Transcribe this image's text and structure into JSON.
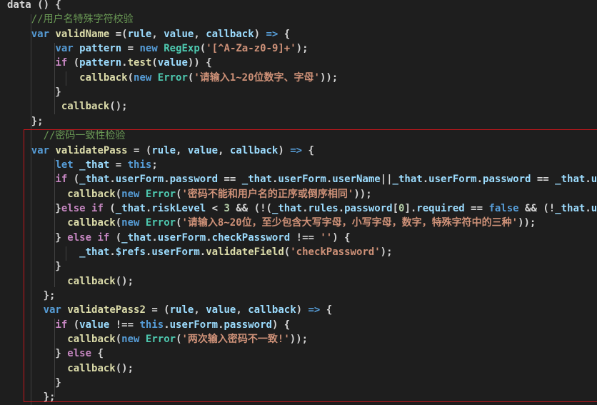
{
  "editor": {
    "theme": {
      "background": "#1e1e1e",
      "keyword": "#569cd6",
      "control": "#c586c0",
      "function": "#dcdcaa",
      "variable": "#9cdcfe",
      "string": "#ce9178",
      "number": "#b5cea8",
      "class": "#4ec9b0",
      "comment": "#6a9955",
      "plain": "#d4d4d4",
      "highlight_border": "#c4161c"
    },
    "lines": [
      [
        [
          "pl",
          "data () {"
        ]
      ],
      [
        [
          "pl",
          "    "
        ],
        [
          "cmt",
          "//用户名特殊字符校验"
        ]
      ],
      [
        [
          "pl",
          "    "
        ],
        [
          "kw",
          "var"
        ],
        [
          "pl",
          " "
        ],
        [
          "fn",
          "validName"
        ],
        [
          "pl",
          " =("
        ],
        [
          "prm",
          "rule"
        ],
        [
          "pl",
          ", "
        ],
        [
          "prm",
          "value"
        ],
        [
          "pl",
          ", "
        ],
        [
          "prm",
          "callback"
        ],
        [
          "pl",
          ") "
        ],
        [
          "kw",
          "=>"
        ],
        [
          "pl",
          " {"
        ]
      ],
      [
        [
          "pl",
          "        "
        ],
        [
          "kw",
          "var"
        ],
        [
          "pl",
          " "
        ],
        [
          "prm",
          "pattern"
        ],
        [
          "pl",
          " = "
        ],
        [
          "kw",
          "new"
        ],
        [
          "pl",
          " "
        ],
        [
          "cls",
          "RegExp"
        ],
        [
          "pl",
          "("
        ],
        [
          "str",
          "'[^A-Za-z0-9]+'"
        ],
        [
          "pl",
          ");"
        ]
      ],
      [
        [
          "pl",
          "        "
        ],
        [
          "ctl",
          "if"
        ],
        [
          "pl",
          " ("
        ],
        [
          "prm",
          "pattern"
        ],
        [
          "pl",
          "."
        ],
        [
          "fn",
          "test"
        ],
        [
          "pl",
          "("
        ],
        [
          "prm",
          "value"
        ],
        [
          "pl",
          ")) {"
        ]
      ],
      [
        [
          "pl",
          "            "
        ],
        [
          "fn",
          "callback"
        ],
        [
          "pl",
          "("
        ],
        [
          "kw",
          "new"
        ],
        [
          "pl",
          " "
        ],
        [
          "cls",
          "Error"
        ],
        [
          "pl",
          "("
        ],
        [
          "str",
          "'请输入1~20位数字、字母'"
        ],
        [
          "pl",
          "));"
        ]
      ],
      [
        [
          "pl",
          "        }"
        ]
      ],
      [
        [
          "pl",
          "         "
        ],
        [
          "fn",
          "callback"
        ],
        [
          "pl",
          "();"
        ]
      ],
      [
        [
          "pl",
          "    };"
        ]
      ],
      [
        [
          "pl",
          "      "
        ],
        [
          "cmt",
          "//密码一致性检验"
        ]
      ],
      [
        [
          "pl",
          "    "
        ],
        [
          "kw",
          "var"
        ],
        [
          "pl",
          " "
        ],
        [
          "fn",
          "validatePass"
        ],
        [
          "pl",
          " = ("
        ],
        [
          "prm",
          "rule"
        ],
        [
          "pl",
          ", "
        ],
        [
          "prm",
          "value"
        ],
        [
          "pl",
          ", "
        ],
        [
          "prm",
          "callback"
        ],
        [
          "pl",
          ") "
        ],
        [
          "kw",
          "=>"
        ],
        [
          "pl",
          " {"
        ]
      ],
      [
        [
          "pl",
          "        "
        ],
        [
          "kw",
          "let"
        ],
        [
          "pl",
          " "
        ],
        [
          "prm",
          "_that"
        ],
        [
          "pl",
          " = "
        ],
        [
          "kw",
          "this"
        ],
        [
          "pl",
          ";"
        ]
      ],
      [
        [
          "pl",
          "        "
        ],
        [
          "ctl",
          "if"
        ],
        [
          "pl",
          " ("
        ],
        [
          "prm",
          "_that"
        ],
        [
          "pl",
          "."
        ],
        [
          "prm",
          "userForm"
        ],
        [
          "pl",
          "."
        ],
        [
          "prm",
          "password"
        ],
        [
          "pl",
          " == "
        ],
        [
          "prm",
          "_that"
        ],
        [
          "pl",
          "."
        ],
        [
          "prm",
          "userForm"
        ],
        [
          "pl",
          "."
        ],
        [
          "prm",
          "userName"
        ],
        [
          "pl",
          "||"
        ],
        [
          "prm",
          "_that"
        ],
        [
          "pl",
          "."
        ],
        [
          "prm",
          "userForm"
        ],
        [
          "pl",
          "."
        ],
        [
          "prm",
          "password"
        ],
        [
          "pl",
          " == "
        ],
        [
          "prm",
          "_that"
        ],
        [
          "pl",
          "."
        ],
        [
          "prm",
          "use"
        ]
      ],
      [
        [
          "pl",
          "          "
        ],
        [
          "fn",
          "callback"
        ],
        [
          "pl",
          "("
        ],
        [
          "kw",
          "new"
        ],
        [
          "pl",
          " "
        ],
        [
          "cls",
          "Error"
        ],
        [
          "pl",
          "("
        ],
        [
          "str",
          "'密码不能和用户名的正序或倒序相同'"
        ],
        [
          "pl",
          "));"
        ]
      ],
      [
        [
          "pl",
          "        }"
        ],
        [
          "ctl",
          "else"
        ],
        [
          "pl",
          " "
        ],
        [
          "ctl",
          "if"
        ],
        [
          "pl",
          " ("
        ],
        [
          "prm",
          "_that"
        ],
        [
          "pl",
          "."
        ],
        [
          "prm",
          "riskLevel"
        ],
        [
          "pl",
          " < "
        ],
        [
          "num",
          "3"
        ],
        [
          "pl",
          " && (!("
        ],
        [
          "prm",
          "_that"
        ],
        [
          "pl",
          "."
        ],
        [
          "prm",
          "rules"
        ],
        [
          "pl",
          "."
        ],
        [
          "prm",
          "password"
        ],
        [
          "pl",
          "["
        ],
        [
          "num",
          "0"
        ],
        [
          "pl",
          "]."
        ],
        [
          "prm",
          "required"
        ],
        [
          "pl",
          " == "
        ],
        [
          "kw",
          "false"
        ],
        [
          "pl",
          " && (!"
        ],
        [
          "prm",
          "_that"
        ],
        [
          "pl",
          "."
        ],
        [
          "prm",
          "use"
        ]
      ],
      [
        [
          "pl",
          "          "
        ],
        [
          "fn",
          "callback"
        ],
        [
          "pl",
          "("
        ],
        [
          "kw",
          "new"
        ],
        [
          "pl",
          " "
        ],
        [
          "cls",
          "Error"
        ],
        [
          "pl",
          "("
        ],
        [
          "str",
          "'请输入8~20位，至少包含大写字母，小写字母，数字，特殊字符中的三种'"
        ],
        [
          "pl",
          "));"
        ]
      ],
      [
        [
          "pl",
          "        } "
        ],
        [
          "ctl",
          "else"
        ],
        [
          "pl",
          " "
        ],
        [
          "ctl",
          "if"
        ],
        [
          "pl",
          " ("
        ],
        [
          "prm",
          "_that"
        ],
        [
          "pl",
          "."
        ],
        [
          "prm",
          "userForm"
        ],
        [
          "pl",
          "."
        ],
        [
          "prm",
          "checkPassword"
        ],
        [
          "pl",
          " !== "
        ],
        [
          "str",
          "''"
        ],
        [
          "pl",
          ") {"
        ]
      ],
      [
        [
          "pl",
          "            "
        ],
        [
          "prm",
          "_that"
        ],
        [
          "pl",
          "."
        ],
        [
          "prm",
          "$refs"
        ],
        [
          "pl",
          "."
        ],
        [
          "prm",
          "userForm"
        ],
        [
          "pl",
          "."
        ],
        [
          "fn",
          "validateField"
        ],
        [
          "pl",
          "("
        ],
        [
          "str",
          "'checkPassword'"
        ],
        [
          "pl",
          ");"
        ]
      ],
      [
        [
          "pl",
          "        }"
        ]
      ],
      [
        [
          "pl",
          "          "
        ],
        [
          "fn",
          "callback"
        ],
        [
          "pl",
          "();"
        ]
      ],
      [
        [
          "pl",
          "      };"
        ]
      ],
      [
        [
          "pl",
          "      "
        ],
        [
          "kw",
          "var"
        ],
        [
          "pl",
          " "
        ],
        [
          "fn",
          "validatePass2"
        ],
        [
          "pl",
          " = ("
        ],
        [
          "prm",
          "rule"
        ],
        [
          "pl",
          ", "
        ],
        [
          "prm",
          "value"
        ],
        [
          "pl",
          ", "
        ],
        [
          "prm",
          "callback"
        ],
        [
          "pl",
          ") "
        ],
        [
          "kw",
          "=>"
        ],
        [
          "pl",
          " {"
        ]
      ],
      [
        [
          "pl",
          "        "
        ],
        [
          "ctl",
          "if"
        ],
        [
          "pl",
          " ("
        ],
        [
          "prm",
          "value"
        ],
        [
          "pl",
          " !== "
        ],
        [
          "kw",
          "this"
        ],
        [
          "pl",
          "."
        ],
        [
          "prm",
          "userForm"
        ],
        [
          "pl",
          "."
        ],
        [
          "prm",
          "password"
        ],
        [
          "pl",
          ") {"
        ]
      ],
      [
        [
          "pl",
          "          "
        ],
        [
          "fn",
          "callback"
        ],
        [
          "pl",
          "("
        ],
        [
          "kw",
          "new"
        ],
        [
          "pl",
          " "
        ],
        [
          "cls",
          "Error"
        ],
        [
          "pl",
          "("
        ],
        [
          "str",
          "'两次输入密码不一致!'"
        ],
        [
          "pl",
          "));"
        ]
      ],
      [
        [
          "pl",
          "        } "
        ],
        [
          "ctl",
          "else"
        ],
        [
          "pl",
          " {"
        ]
      ],
      [
        [
          "pl",
          "          "
        ],
        [
          "fn",
          "callback"
        ],
        [
          "pl",
          "();"
        ]
      ],
      [
        [
          "pl",
          "        }"
        ]
      ],
      [
        [
          "pl",
          "      };"
        ]
      ]
    ]
  }
}
